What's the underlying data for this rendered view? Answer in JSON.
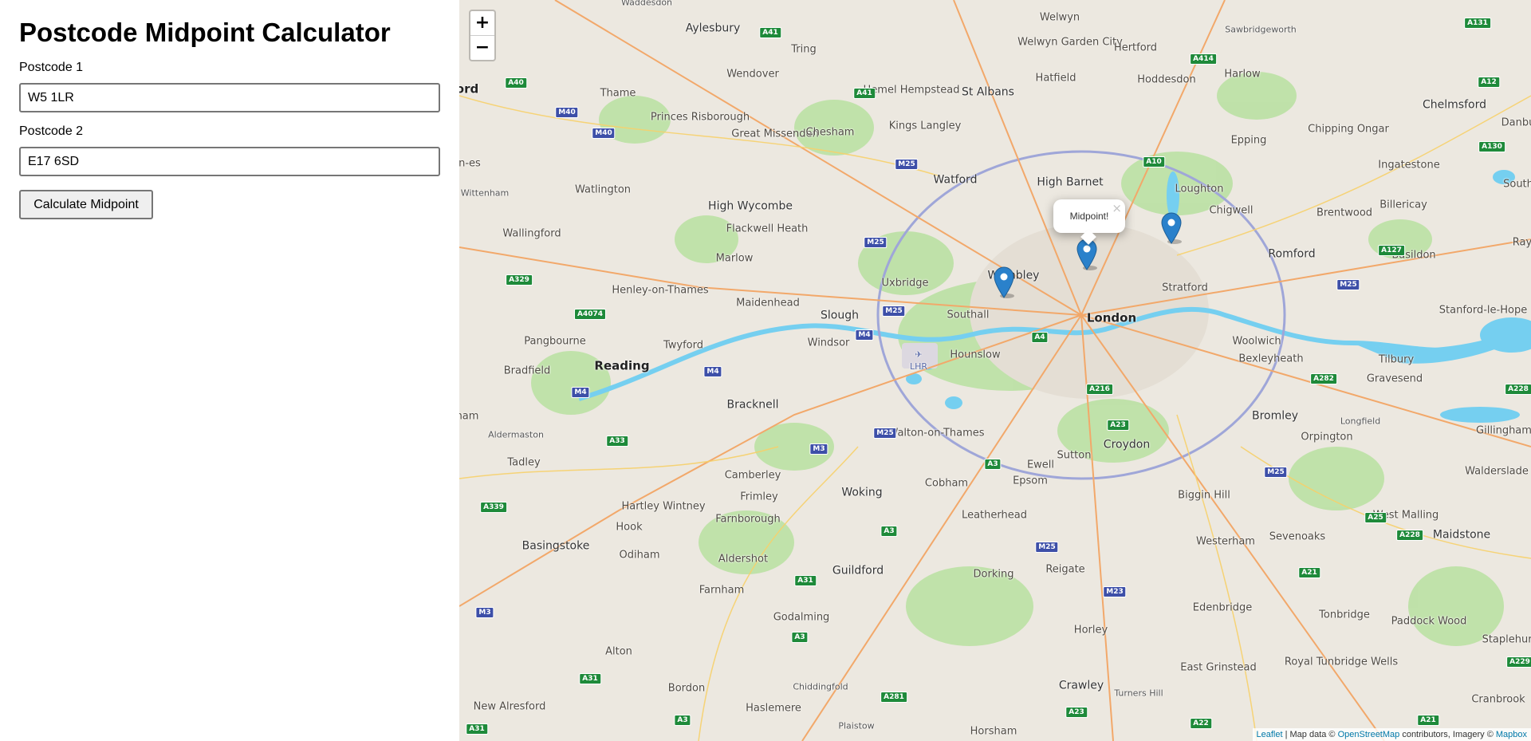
{
  "page": {
    "title": "Postcode Midpoint Calculator",
    "postcode1_label": "Postcode 1",
    "postcode1_value": "W5 1LR",
    "postcode2_label": "Postcode 2",
    "postcode2_value": "E17 6SD",
    "calculate_button": "Calculate Midpoint"
  },
  "map": {
    "zoom_in": "+",
    "zoom_out": "−",
    "popup_text": "Midpoint!",
    "popup_close": "×",
    "marker_color": "#2a81cb",
    "water_color": "#75cff0",
    "park_color": "#b8e0a0",
    "attribution": {
      "leaflet": "Leaflet",
      "sep1": " | Map data © ",
      "osm": "OpenStreetMap",
      "mid": " contributors, Imagery © ",
      "mapbox": "Mapbox"
    },
    "places": [
      {
        "name": "London",
        "class": "big"
      },
      {
        "name": "Reading",
        "class": "big"
      },
      {
        "name": "Waddesdon",
        "class": "small"
      },
      {
        "name": "Welwyn",
        "class": ""
      },
      {
        "name": "Sawbridgeworth",
        "class": "small"
      },
      {
        "name": "Aylesbury",
        "class": "med"
      },
      {
        "name": "Tring",
        "class": ""
      },
      {
        "name": "Welwyn Garden City",
        "class": ""
      },
      {
        "name": "Hertford",
        "class": ""
      },
      {
        "name": "Wendover",
        "class": ""
      },
      {
        "name": "Hatfield",
        "class": ""
      },
      {
        "name": "Hoddesdon",
        "class": ""
      },
      {
        "name": "Harlow",
        "class": ""
      },
      {
        "name": "Chelmsford",
        "class": "med"
      },
      {
        "name": "Thame",
        "class": ""
      },
      {
        "name": "Hemel Hempstead",
        "class": ""
      },
      {
        "name": "St Albans",
        "class": "med"
      },
      {
        "name": "Princes Risborough",
        "class": ""
      },
      {
        "name": "Great Missenden",
        "class": ""
      },
      {
        "name": "Chesham",
        "class": ""
      },
      {
        "name": "Kings Langley",
        "class": ""
      },
      {
        "name": "Chipping Ongar",
        "class": ""
      },
      {
        "name": "Epping",
        "class": ""
      },
      {
        "name": "Watlington",
        "class": ""
      },
      {
        "name": "Watford",
        "class": "med"
      },
      {
        "name": "High Barnet",
        "class": "med"
      },
      {
        "name": "Loughton",
        "class": ""
      },
      {
        "name": "Ingatestone",
        "class": ""
      },
      {
        "name": "High Wycombe",
        "class": "med"
      },
      {
        "name": "Flackwell Heath",
        "class": ""
      },
      {
        "name": "Chigwell",
        "class": ""
      },
      {
        "name": "Brentwood",
        "class": ""
      },
      {
        "name": "Billericay",
        "class": ""
      },
      {
        "name": "Wallingford",
        "class": ""
      },
      {
        "name": "Marlow",
        "class": ""
      },
      {
        "name": "Wembley",
        "class": "med"
      },
      {
        "name": "Romford",
        "class": "med"
      },
      {
        "name": "Basildon",
        "class": ""
      },
      {
        "name": "Henley-on-Thames",
        "class": ""
      },
      {
        "name": "Uxbridge",
        "class": ""
      },
      {
        "name": "Stratford",
        "class": ""
      },
      {
        "name": "Maidenhead",
        "class": ""
      },
      {
        "name": "Slough",
        "class": "med"
      },
      {
        "name": "Southall",
        "class": ""
      },
      {
        "name": "Stanford-le-Hope",
        "class": ""
      },
      {
        "name": "Pangbourne",
        "class": ""
      },
      {
        "name": "Twyford",
        "class": ""
      },
      {
        "name": "Windsor",
        "class": ""
      },
      {
        "name": "Hounslow",
        "class": ""
      },
      {
        "name": "Woolwich",
        "class": ""
      },
      {
        "name": "Bexleyheath",
        "class": ""
      },
      {
        "name": "Tilbury",
        "class": ""
      },
      {
        "name": "Gravesend",
        "class": ""
      },
      {
        "name": "Bradfield",
        "class": ""
      },
      {
        "name": "Bracknell",
        "class": "med"
      },
      {
        "name": "Walton-on-Thames",
        "class": ""
      },
      {
        "name": "Bromley",
        "class": "med"
      },
      {
        "name": "Orpington",
        "class": ""
      },
      {
        "name": "Aldermaston",
        "class": "small"
      },
      {
        "name": "Croydon",
        "class": "med"
      },
      {
        "name": "Sutton",
        "class": ""
      },
      {
        "name": "Longfield",
        "class": "small"
      },
      {
        "name": "Gillingham",
        "class": ""
      },
      {
        "name": "Tadley",
        "class": ""
      },
      {
        "name": "Ewell",
        "class": ""
      },
      {
        "name": "Camberley",
        "class": ""
      },
      {
        "name": "Epsom",
        "class": ""
      },
      {
        "name": "Cobham",
        "class": ""
      },
      {
        "name": "Frimley",
        "class": ""
      },
      {
        "name": "Walderslade",
        "class": ""
      },
      {
        "name": "Woking",
        "class": "med"
      },
      {
        "name": "Biggin Hill",
        "class": ""
      },
      {
        "name": "Hartley Wintney",
        "class": ""
      },
      {
        "name": "Farnborough",
        "class": ""
      },
      {
        "name": "Leatherhead",
        "class": ""
      },
      {
        "name": "West Malling",
        "class": ""
      },
      {
        "name": "Hook",
        "class": ""
      },
      {
        "name": "Westerham",
        "class": ""
      },
      {
        "name": "Sevenoaks",
        "class": ""
      },
      {
        "name": "Maidstone",
        "class": "med"
      },
      {
        "name": "Basingstoke",
        "class": "med"
      },
      {
        "name": "Odiham",
        "class": ""
      },
      {
        "name": "Aldershot",
        "class": ""
      },
      {
        "name": "Reigate",
        "class": ""
      },
      {
        "name": "Guildford",
        "class": "med"
      },
      {
        "name": "Dorking",
        "class": ""
      },
      {
        "name": "Farnham",
        "class": ""
      },
      {
        "name": "Edenbridge",
        "class": ""
      },
      {
        "name": "Tonbridge",
        "class": ""
      },
      {
        "name": "Paddock Wood",
        "class": ""
      },
      {
        "name": "Godalming",
        "class": ""
      },
      {
        "name": "Horley",
        "class": ""
      },
      {
        "name": "Staplehurst",
        "class": ""
      },
      {
        "name": "Alton",
        "class": ""
      },
      {
        "name": "Royal Tunbridge Wells",
        "class": ""
      },
      {
        "name": "East Grinstead",
        "class": ""
      },
      {
        "name": "Chiddingfold",
        "class": "small"
      },
      {
        "name": "Bordon",
        "class": ""
      },
      {
        "name": "Turners Hill",
        "class": "small"
      },
      {
        "name": "Crawley",
        "class": "med"
      },
      {
        "name": "Cranbrook",
        "class": ""
      },
      {
        "name": "New Alresford",
        "class": ""
      },
      {
        "name": "Haslemere",
        "class": ""
      },
      {
        "name": "Plaistow",
        "class": "small"
      },
      {
        "name": "Horsham",
        "class": ""
      },
      {
        "name": "Danbu",
        "class": ""
      },
      {
        "name": "South",
        "class": ""
      },
      {
        "name": "Ray",
        "class": ""
      },
      {
        "name": "ord",
        "class": "big"
      },
      {
        "name": "on-es",
        "class": ""
      },
      {
        "name": "Wittenham",
        "class": "small"
      },
      {
        "name": "ham",
        "class": ""
      }
    ],
    "roads": [
      {
        "label": "A131",
        "type": "a"
      },
      {
        "label": "A41",
        "type": "a"
      },
      {
        "label": "A414",
        "type": "a"
      },
      {
        "label": "A12",
        "type": "a"
      },
      {
        "label": "A40",
        "type": "a"
      },
      {
        "label": "A41",
        "type": "a"
      },
      {
        "label": "M40",
        "type": "m"
      },
      {
        "label": "M40",
        "type": "m"
      },
      {
        "label": "A130",
        "type": "a"
      },
      {
        "label": "A10",
        "type": "a"
      },
      {
        "label": "M25",
        "type": "m"
      },
      {
        "label": "M25",
        "type": "m"
      },
      {
        "label": "A127",
        "type": "a"
      },
      {
        "label": "A329",
        "type": "a"
      },
      {
        "label": "M25",
        "type": "m"
      },
      {
        "label": "A4074",
        "type": "a"
      },
      {
        "label": "M25",
        "type": "m"
      },
      {
        "label": "M4",
        "type": "m"
      },
      {
        "label": "A4",
        "type": "a"
      },
      {
        "label": "M4",
        "type": "m"
      },
      {
        "label": "M4",
        "type": "m"
      },
      {
        "label": "A282",
        "type": "a"
      },
      {
        "label": "A216",
        "type": "a"
      },
      {
        "label": "A228",
        "type": "a"
      },
      {
        "label": "M25",
        "type": "m"
      },
      {
        "label": "A33",
        "type": "a"
      },
      {
        "label": "A23",
        "type": "a"
      },
      {
        "label": "M3",
        "type": "m"
      },
      {
        "label": "A3",
        "type": "a"
      },
      {
        "label": "M25",
        "type": "m"
      },
      {
        "label": "A339",
        "type": "a"
      },
      {
        "label": "A25",
        "type": "a"
      },
      {
        "label": "A228",
        "type": "a"
      },
      {
        "label": "A3",
        "type": "a"
      },
      {
        "label": "M25",
        "type": "m"
      },
      {
        "label": "A21",
        "type": "a"
      },
      {
        "label": "A31",
        "type": "a"
      },
      {
        "label": "M23",
        "type": "m"
      },
      {
        "label": "M3",
        "type": "m"
      },
      {
        "label": "A3",
        "type": "a"
      },
      {
        "label": "A229",
        "type": "a"
      },
      {
        "label": "A31",
        "type": "a"
      },
      {
        "label": "A281",
        "type": "a"
      },
      {
        "label": "A3",
        "type": "a"
      },
      {
        "label": "A23",
        "type": "a"
      },
      {
        "label": "A22",
        "type": "a"
      },
      {
        "label": "A21",
        "type": "a"
      },
      {
        "label": "A31",
        "type": "a"
      }
    ]
  }
}
